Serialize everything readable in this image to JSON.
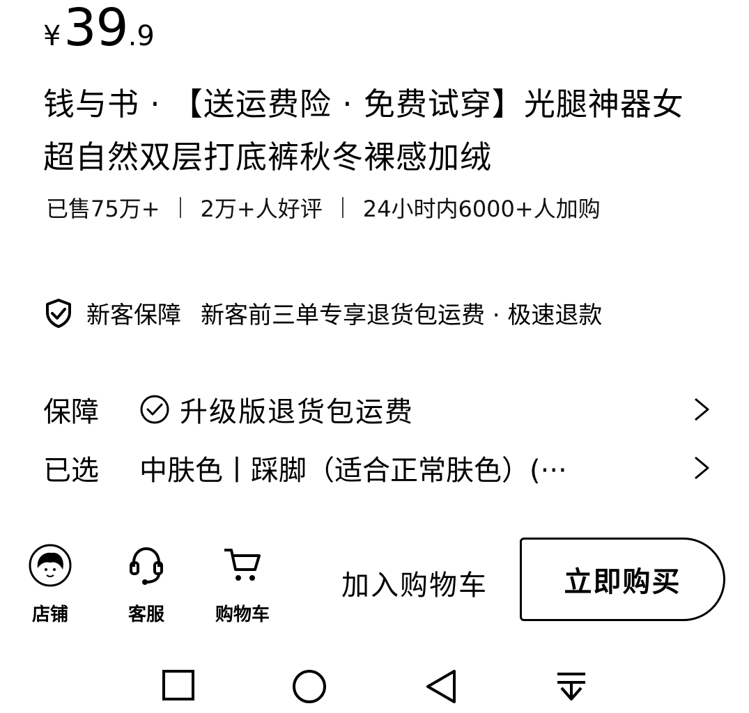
{
  "price": {
    "currency": "¥",
    "integer": "39",
    "decimal": ".9"
  },
  "title": "钱与书 · 【送运费险 · 免费试穿】光腿神器女超自然双层打底裤秋冬裸感加绒",
  "stats": {
    "sold": "已售75万+",
    "reviews": "2万+人好评",
    "cart": "24小时内6000+人加购"
  },
  "guarantee": {
    "label": "新客保障",
    "text": "新客前三单专享退货包运费 · 极速退款",
    "icon": "shield-check-icon"
  },
  "rows": [
    {
      "label": "保障",
      "value": "升级版退货包运费",
      "icon": "circle-check-icon"
    },
    {
      "label": "已选",
      "value": "中肤色丨踩脚（适合正常肤色）(···"
    }
  ],
  "action_bar": {
    "shop_label": "店铺",
    "service_label": "客服",
    "cart_label": "购物车",
    "add_to_cart": "加入购物车",
    "buy_now": "立即购买"
  },
  "nav": [
    "square-icon",
    "circle-icon",
    "back-triangle-icon",
    "notification-down-icon"
  ]
}
